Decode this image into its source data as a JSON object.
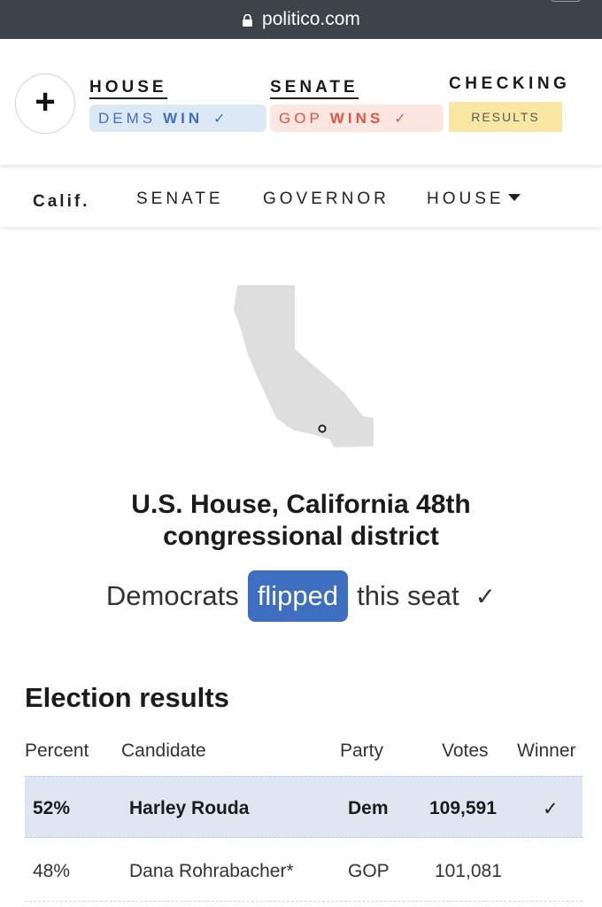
{
  "browser": {
    "url": "politico.com"
  },
  "header": {
    "plus_label": "+",
    "house": {
      "title": "HOUSE",
      "pill_party": "DEMS",
      "pill_result": "WIN",
      "check": "✓"
    },
    "senate": {
      "title": "SENATE",
      "pill_party": "GOP",
      "pill_result": "WINS",
      "check": "✓"
    },
    "checking": {
      "title": "CHECKING",
      "results_label": "RESULTS"
    }
  },
  "subnav": {
    "state": "Calif.",
    "items": [
      "SENATE",
      "GOVERNOR",
      "HOUSE"
    ]
  },
  "race": {
    "title_line1": "U.S. House, California 48th",
    "title_line2": "congressional district",
    "flip_prefix": "Democrats",
    "flip_word": "flipped",
    "flip_suffix": "this seat",
    "flip_check": "✓"
  },
  "results": {
    "heading": "Election results",
    "columns": [
      "Percent",
      "Candidate",
      "Party",
      "Votes",
      "Winner"
    ],
    "rows": [
      {
        "percent": "52%",
        "candidate": "Harley Rouda",
        "party": "Dem",
        "votes": "109,591",
        "winner": "✓"
      },
      {
        "percent": "48%",
        "candidate": "Dana Rohrabacher*",
        "party": "GOP",
        "votes": "101,081",
        "winner": ""
      }
    ]
  },
  "colors": {
    "dem_blue": "#3e6ec0",
    "gop_red": "#de5640",
    "results_yellow": "#f7e7a3",
    "map_gray": "#dedede"
  },
  "icons": [
    "lock-icon",
    "plus-icon",
    "caret-down-icon",
    "california-map",
    "district-marker"
  ]
}
